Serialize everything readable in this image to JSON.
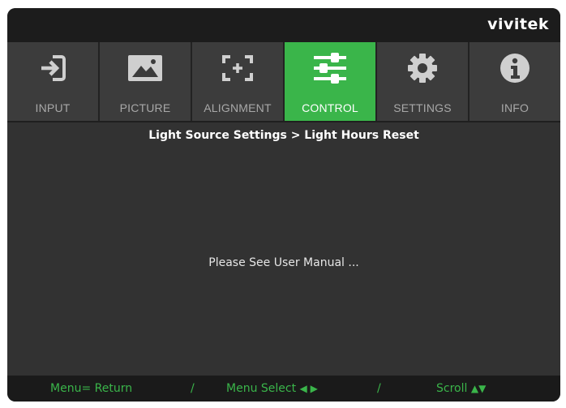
{
  "brand": {
    "logo_text": "vivitek"
  },
  "tabs": [
    {
      "label": "INPUT",
      "icon": "input-arrow-icon",
      "active": false
    },
    {
      "label": "PICTURE",
      "icon": "picture-icon",
      "active": false
    },
    {
      "label": "ALIGNMENT",
      "icon": "alignment-icon",
      "active": false
    },
    {
      "label": "CONTROL",
      "icon": "sliders-icon",
      "active": true
    },
    {
      "label": "SETTINGS",
      "icon": "gear-icon",
      "active": false
    },
    {
      "label": "INFO",
      "icon": "info-icon",
      "active": false
    }
  ],
  "content": {
    "breadcrumb": "Light Source Settings > Light Hours Reset",
    "message": "Please See User Manual ..."
  },
  "footer": {
    "return_hint": "Menu= Return",
    "separator": "/",
    "select_hint": "Menu Select",
    "select_arrows": "◀ ▶",
    "scroll_hint": "Scroll",
    "scroll_arrows": "▲▼"
  },
  "colors": {
    "accent": "#3ab54a",
    "panel": "#323232",
    "tab_inactive": "#3c3c3c",
    "bar": "#1c1c1c"
  }
}
